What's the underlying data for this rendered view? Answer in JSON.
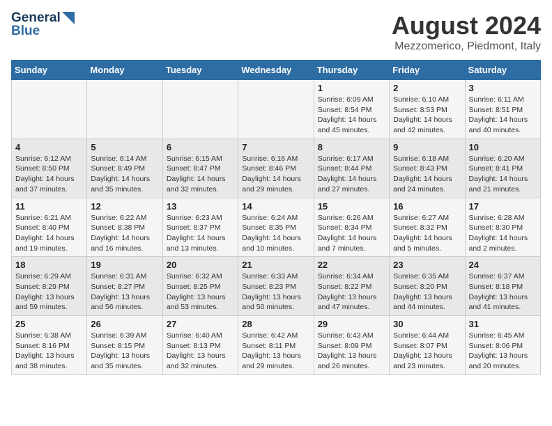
{
  "header": {
    "logo_line1": "General",
    "logo_line2": "Blue",
    "month_year": "August 2024",
    "location": "Mezzomerico, Piedmont, Italy"
  },
  "weekdays": [
    "Sunday",
    "Monday",
    "Tuesday",
    "Wednesday",
    "Thursday",
    "Friday",
    "Saturday"
  ],
  "weeks": [
    [
      {
        "day": "",
        "info": ""
      },
      {
        "day": "",
        "info": ""
      },
      {
        "day": "",
        "info": ""
      },
      {
        "day": "",
        "info": ""
      },
      {
        "day": "1",
        "info": "Sunrise: 6:09 AM\nSunset: 8:54 PM\nDaylight: 14 hours\nand 45 minutes."
      },
      {
        "day": "2",
        "info": "Sunrise: 6:10 AM\nSunset: 8:53 PM\nDaylight: 14 hours\nand 42 minutes."
      },
      {
        "day": "3",
        "info": "Sunrise: 6:11 AM\nSunset: 8:51 PM\nDaylight: 14 hours\nand 40 minutes."
      }
    ],
    [
      {
        "day": "4",
        "info": "Sunrise: 6:12 AM\nSunset: 8:50 PM\nDaylight: 14 hours\nand 37 minutes."
      },
      {
        "day": "5",
        "info": "Sunrise: 6:14 AM\nSunset: 8:49 PM\nDaylight: 14 hours\nand 35 minutes."
      },
      {
        "day": "6",
        "info": "Sunrise: 6:15 AM\nSunset: 8:47 PM\nDaylight: 14 hours\nand 32 minutes."
      },
      {
        "day": "7",
        "info": "Sunrise: 6:16 AM\nSunset: 8:46 PM\nDaylight: 14 hours\nand 29 minutes."
      },
      {
        "day": "8",
        "info": "Sunrise: 6:17 AM\nSunset: 8:44 PM\nDaylight: 14 hours\nand 27 minutes."
      },
      {
        "day": "9",
        "info": "Sunrise: 6:18 AM\nSunset: 8:43 PM\nDaylight: 14 hours\nand 24 minutes."
      },
      {
        "day": "10",
        "info": "Sunrise: 6:20 AM\nSunset: 8:41 PM\nDaylight: 14 hours\nand 21 minutes."
      }
    ],
    [
      {
        "day": "11",
        "info": "Sunrise: 6:21 AM\nSunset: 8:40 PM\nDaylight: 14 hours\nand 19 minutes."
      },
      {
        "day": "12",
        "info": "Sunrise: 6:22 AM\nSunset: 8:38 PM\nDaylight: 14 hours\nand 16 minutes."
      },
      {
        "day": "13",
        "info": "Sunrise: 6:23 AM\nSunset: 8:37 PM\nDaylight: 14 hours\nand 13 minutes."
      },
      {
        "day": "14",
        "info": "Sunrise: 6:24 AM\nSunset: 8:35 PM\nDaylight: 14 hours\nand 10 minutes."
      },
      {
        "day": "15",
        "info": "Sunrise: 6:26 AM\nSunset: 8:34 PM\nDaylight: 14 hours\nand 7 minutes."
      },
      {
        "day": "16",
        "info": "Sunrise: 6:27 AM\nSunset: 8:32 PM\nDaylight: 14 hours\nand 5 minutes."
      },
      {
        "day": "17",
        "info": "Sunrise: 6:28 AM\nSunset: 8:30 PM\nDaylight: 14 hours\nand 2 minutes."
      }
    ],
    [
      {
        "day": "18",
        "info": "Sunrise: 6:29 AM\nSunset: 8:29 PM\nDaylight: 13 hours\nand 59 minutes."
      },
      {
        "day": "19",
        "info": "Sunrise: 6:31 AM\nSunset: 8:27 PM\nDaylight: 13 hours\nand 56 minutes."
      },
      {
        "day": "20",
        "info": "Sunrise: 6:32 AM\nSunset: 8:25 PM\nDaylight: 13 hours\nand 53 minutes."
      },
      {
        "day": "21",
        "info": "Sunrise: 6:33 AM\nSunset: 8:23 PM\nDaylight: 13 hours\nand 50 minutes."
      },
      {
        "day": "22",
        "info": "Sunrise: 6:34 AM\nSunset: 8:22 PM\nDaylight: 13 hours\nand 47 minutes."
      },
      {
        "day": "23",
        "info": "Sunrise: 6:35 AM\nSunset: 8:20 PM\nDaylight: 13 hours\nand 44 minutes."
      },
      {
        "day": "24",
        "info": "Sunrise: 6:37 AM\nSunset: 8:18 PM\nDaylight: 13 hours\nand 41 minutes."
      }
    ],
    [
      {
        "day": "25",
        "info": "Sunrise: 6:38 AM\nSunset: 8:16 PM\nDaylight: 13 hours\nand 38 minutes."
      },
      {
        "day": "26",
        "info": "Sunrise: 6:39 AM\nSunset: 8:15 PM\nDaylight: 13 hours\nand 35 minutes."
      },
      {
        "day": "27",
        "info": "Sunrise: 6:40 AM\nSunset: 8:13 PM\nDaylight: 13 hours\nand 32 minutes."
      },
      {
        "day": "28",
        "info": "Sunrise: 6:42 AM\nSunset: 8:11 PM\nDaylight: 13 hours\nand 29 minutes."
      },
      {
        "day": "29",
        "info": "Sunrise: 6:43 AM\nSunset: 8:09 PM\nDaylight: 13 hours\nand 26 minutes."
      },
      {
        "day": "30",
        "info": "Sunrise: 6:44 AM\nSunset: 8:07 PM\nDaylight: 13 hours\nand 23 minutes."
      },
      {
        "day": "31",
        "info": "Sunrise: 6:45 AM\nSunset: 8:06 PM\nDaylight: 13 hours\nand 20 minutes."
      }
    ]
  ]
}
